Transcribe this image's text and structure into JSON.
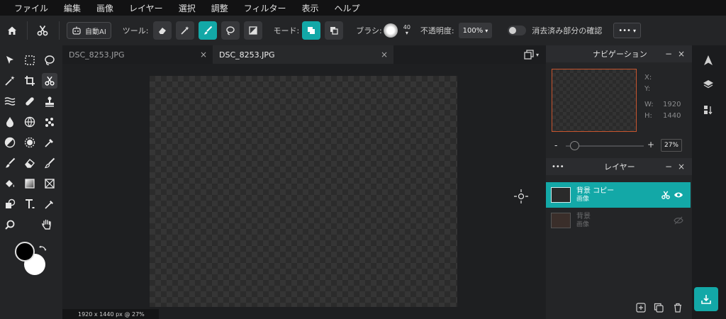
{
  "menu": [
    "ファイル",
    "編集",
    "画像",
    "レイヤー",
    "選択",
    "調整",
    "フィルター",
    "表示",
    "ヘルプ"
  ],
  "toolbar": {
    "auto_ai_label": "自動AI",
    "tool_label": "ツール:",
    "mode_label": "モード:",
    "brush_label": "ブラシ:",
    "brush_size": "40",
    "opacity_label": "不透明度:",
    "opacity_value": "100%",
    "erased_check_label": "消去済み部分の確認",
    "more_label": "•••"
  },
  "tabs": [
    {
      "label": "DSC_8253.JPG",
      "close": "×"
    },
    {
      "label": "DSC_8253.JPG",
      "close": "×"
    }
  ],
  "status": {
    "text": "1920 x 1440 px @ 27%"
  },
  "navigator": {
    "title": "ナビゲーション",
    "minimize": "−",
    "close": "×",
    "x_label": "X:",
    "y_label": "Y:",
    "w_label": "W:",
    "w_value": "1920",
    "h_label": "H:",
    "h_value": "1440",
    "zoom_minus": "-",
    "zoom_plus": "+",
    "zoom_value": "27%"
  },
  "layers": {
    "menu": "•••",
    "title": "レイヤー",
    "minimize": "−",
    "close": "×",
    "items": [
      {
        "name": "背景 コピー",
        "type": "画像"
      },
      {
        "name": "背景",
        "type": "画像"
      }
    ]
  },
  "colors": {
    "accent": "#13a8a7",
    "foreground": "#000000",
    "background": "#ffffff"
  }
}
